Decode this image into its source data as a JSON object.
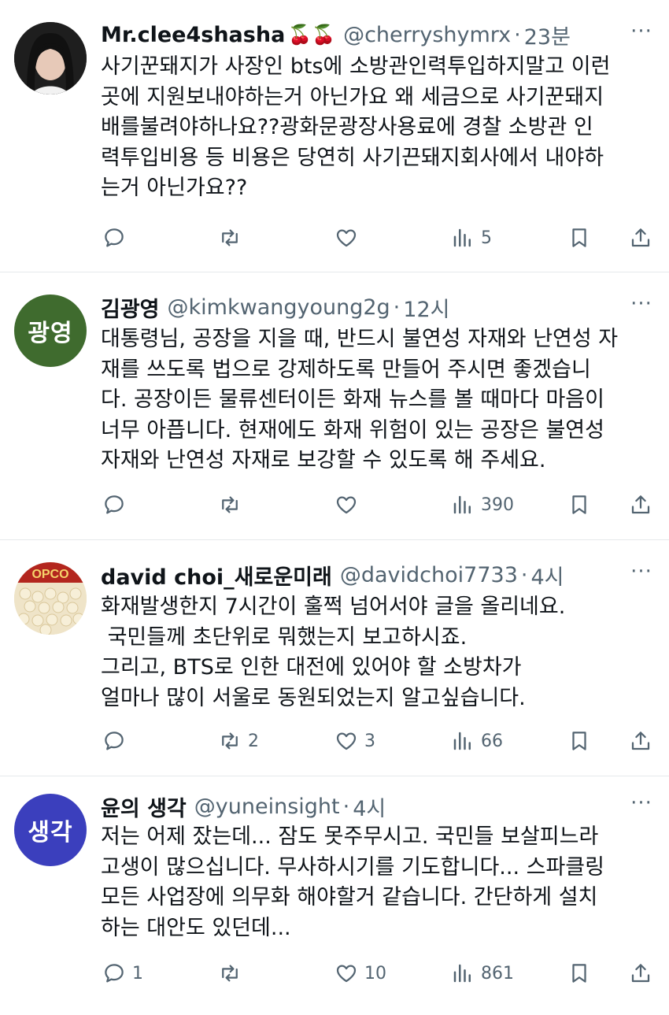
{
  "tweets": [
    {
      "name": "Mr.clee4shasha",
      "emoji": "🍒🍒",
      "handle": "@cherryshymrx",
      "time": "23분",
      "lines": [
        "사기꾼돼지가 사장인 bts에 소방관인력투입하지말고 이런",
        "곳에 지원보내야하는거 아닌가요 왜 세금으로 사기꾼돼지",
        "배를불려야하나요??광화문광장사용료에 경찰 소방관 인",
        "력투입비용 등 비용은 당연히 사기끈돼지회사에서 내야하",
        "는거 아닌가요??"
      ],
      "replies": "",
      "reposts": "",
      "likes": "",
      "views": "5",
      "avatar": {
        "type": "photo",
        "bg": "#2a2a2a"
      }
    },
    {
      "name": "김광영",
      "emoji": "",
      "handle": "@kimkwangyoung2g",
      "time": "12시",
      "lines": [
        "대통령님, 공장을 지을 때, 반드시 불연성 자재와 난연성 자",
        "재를 쓰도록 법으로 강제하도록 만들어 주시면 좋겠습니",
        "다. 공장이든 물류센터이든 화재 뉴스를 볼 때마다 마음이",
        "너무 아픕니다. 현재에도 화재 위험이 있는 공장은 불연성",
        "자재와 난연성 자재로 보강할 수 있도록 해 주세요."
      ],
      "replies": "",
      "reposts": "",
      "likes": "",
      "views": "390",
      "avatar": {
        "type": "text",
        "text": "광영",
        "bg": "#3f6b2e"
      }
    },
    {
      "name": "david choi_새로운미래",
      "emoji": "",
      "handle": "@davidchoi7733",
      "time": "4시",
      "lines": [
        "화재발생한지 7시간이 훌쩍 넘어서야 글을 올리네요.",
        " 국민들께 초단위로 뭐했는지 보고하시죠.",
        "그리고, BTS로 인한 대전에 있어야 할 소방차가",
        "얼마나 많이 서울로 동원되었는지 알고싶습니다."
      ],
      "replies": "",
      "reposts": "2",
      "likes": "3",
      "views": "66",
      "avatar": {
        "type": "photo",
        "bg": "#e9dcc0"
      }
    },
    {
      "name": "윤의 생각",
      "emoji": "",
      "handle": "@yuneinsight",
      "time": "4시",
      "lines": [
        "저는 어제 잤는데... 잠도 못주무시고. 국민들 보살피느라",
        "고생이 많으십니다. 무사하시기를 기도합니다... 스파클링",
        "모든 사업장에 의무화 해야할거 같습니다. 간단하게 설치",
        "하는 대안도 있던데..."
      ],
      "replies": "1",
      "reposts": "",
      "likes": "10",
      "views": "861",
      "avatar": {
        "type": "text",
        "text": "생각",
        "bg": "#3b3fbd"
      }
    }
  ]
}
